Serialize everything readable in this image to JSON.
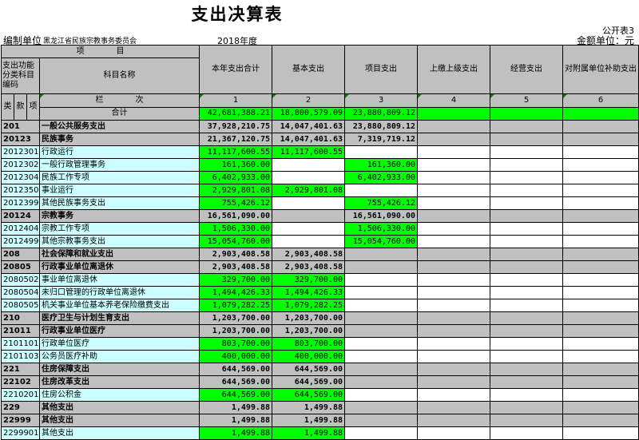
{
  "title": "支出决算表",
  "form_no": "公开表3",
  "unit_label": "编制单位",
  "unit_name": "黑龙江省民族宗教事务委员会",
  "year": "2018年度",
  "amount_unit": "金额单位：元",
  "header": {
    "project": "项　　　　目",
    "func_code": "支出功能分类科目编码",
    "subject_name": "科目名称",
    "cols": [
      "本年支出合计",
      "基本支出",
      "项目支出",
      "上缴上级支出",
      "经营支出",
      "对附属单位补助支出"
    ],
    "lei": "类",
    "kuan": "款",
    "xiang": "项",
    "lan_ci": "栏　　　　次",
    "col_nums": [
      "1",
      "2",
      "3",
      "4",
      "5",
      "6"
    ],
    "total_label": "合计",
    "total_values": [
      "42,681,388.21",
      "18,800,579.09",
      "23,880,809.12",
      "",
      "",
      ""
    ]
  },
  "rows": [
    {
      "code": "201",
      "name": "一般公共服务支出",
      "v": [
        "37,928,210.75",
        "14,047,401.63",
        "23,880,809.12"
      ],
      "level": 1
    },
    {
      "code": "20123",
      "name": "民族事务",
      "v": [
        "21,367,120.75",
        "14,047,401.63",
        "7,319,719.12"
      ],
      "level": 2
    },
    {
      "code": "2012301",
      "name": "行政运行",
      "v": [
        "11,117,600.55",
        "11,117,600.55",
        ""
      ],
      "level": 3
    },
    {
      "code": "2012302",
      "name": "一般行政管理事务",
      "v": [
        "161,360.00",
        "",
        "161,360.00"
      ],
      "level": 3
    },
    {
      "code": "2012304",
      "name": "民族工作专项",
      "v": [
        "6,402,933.00",
        "",
        "6,402,933.00"
      ],
      "level": 3
    },
    {
      "code": "2012350",
      "name": "事业运行",
      "v": [
        "2,929,801.08",
        "2,929,801.08",
        ""
      ],
      "level": 3
    },
    {
      "code": "2012399",
      "name": "其他民族事务支出",
      "v": [
        "755,426.12",
        "",
        "755,426.12"
      ],
      "level": 3
    },
    {
      "code": "20124",
      "name": "宗教事务",
      "v": [
        "16,561,090.00",
        "",
        "16,561,090.00"
      ],
      "level": 2
    },
    {
      "code": "2012404",
      "name": "宗教工作专项",
      "v": [
        "1,506,330.00",
        "",
        "1,506,330.00"
      ],
      "level": 3
    },
    {
      "code": "2012499",
      "name": "其他宗教事务支出",
      "v": [
        "15,054,760.00",
        "",
        "15,054,760.00"
      ],
      "level": 3
    },
    {
      "code": "208",
      "name": "社会保障和就业支出",
      "v": [
        "2,903,408.58",
        "2,903,408.58",
        ""
      ],
      "level": 1
    },
    {
      "code": "20805",
      "name": "行政事业单位离退休",
      "v": [
        "2,903,408.58",
        "2,903,408.58",
        ""
      ],
      "level": 2
    },
    {
      "code": "2080502",
      "name": "事业单位离退休",
      "v": [
        "329,700.00",
        "329,700.00",
        ""
      ],
      "level": 3
    },
    {
      "code": "2080504",
      "name": "未归口管理的行政单位离退休",
      "v": [
        "1,494,426.33",
        "1,494,426.33",
        ""
      ],
      "level": 3
    },
    {
      "code": "2080505",
      "name": "机关事业单位基本养老保险缴费支出",
      "v": [
        "1,079,282.25",
        "1,079,282.25",
        ""
      ],
      "level": 3
    },
    {
      "code": "210",
      "name": "医疗卫生与计划生育支出",
      "v": [
        "1,203,700.00",
        "1,203,700.00",
        ""
      ],
      "level": 1
    },
    {
      "code": "21011",
      "name": "行政事业单位医疗",
      "v": [
        "1,203,700.00",
        "1,203,700.00",
        ""
      ],
      "level": 2
    },
    {
      "code": "2101101",
      "name": "行政单位医疗",
      "v": [
        "803,700.00",
        "803,700.00",
        ""
      ],
      "level": 3
    },
    {
      "code": "2101103",
      "name": "公务员医疗补助",
      "v": [
        "400,000.00",
        "400,000.00",
        ""
      ],
      "level": 3
    },
    {
      "code": "221",
      "name": "住房保障支出",
      "v": [
        "644,569.00",
        "644,569.00",
        ""
      ],
      "level": 1
    },
    {
      "code": "22102",
      "name": "住房改革支出",
      "v": [
        "644,569.00",
        "644,569.00",
        ""
      ],
      "level": 2
    },
    {
      "code": "2210201",
      "name": "住房公积金",
      "v": [
        "644,569.00",
        "644,569.00",
        ""
      ],
      "level": 3
    },
    {
      "code": "229",
      "name": "其他支出",
      "v": [
        "1,499.88",
        "1,499.88",
        ""
      ],
      "level": 1
    },
    {
      "code": "22999",
      "name": "其他支出",
      "v": [
        "1,499.88",
        "1,499.88",
        ""
      ],
      "level": 2
    },
    {
      "code": "2299901",
      "name": "其他支出",
      "v": [
        "1,499.88",
        "1,499.88",
        ""
      ],
      "level": 3
    }
  ]
}
